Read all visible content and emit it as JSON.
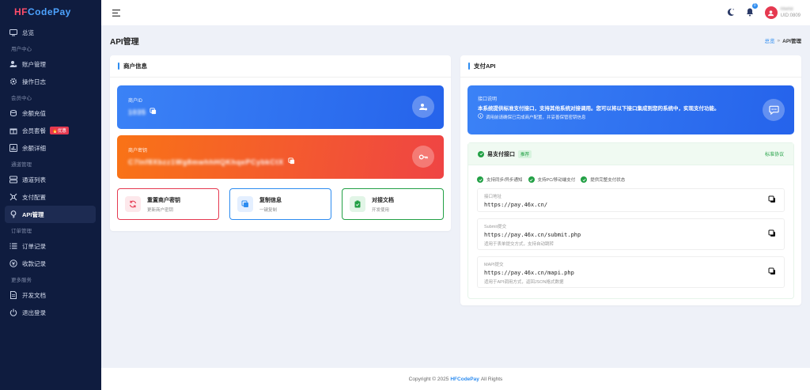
{
  "brand": {
    "logo_part1": "HF",
    "logo_part2": "CodePay"
  },
  "sidebar": {
    "items": [
      {
        "type": "item",
        "label": "总览",
        "icon": "monitor-icon"
      },
      {
        "type": "section",
        "label": "用户中心"
      },
      {
        "type": "item",
        "label": "账户管理",
        "icon": "user-gear-icon"
      },
      {
        "type": "item",
        "label": "操作日志",
        "icon": "settings-icon"
      },
      {
        "type": "section",
        "label": "会员中心"
      },
      {
        "type": "item",
        "label": "余额充值",
        "icon": "coins-icon"
      },
      {
        "type": "item",
        "label": "会员套餐",
        "icon": "gift-icon",
        "badge": "🔥优惠"
      },
      {
        "type": "item",
        "label": "余额详细",
        "icon": "chart-icon"
      },
      {
        "type": "section",
        "label": "通道管理"
      },
      {
        "type": "item",
        "label": "通道列表",
        "icon": "server-icon"
      },
      {
        "type": "item",
        "label": "支付配置",
        "icon": "config-icon"
      },
      {
        "type": "item",
        "label": "API管理",
        "icon": "key-icon",
        "active": true
      },
      {
        "type": "section",
        "label": "订单管理"
      },
      {
        "type": "item",
        "label": "订单记录",
        "icon": "list-icon"
      },
      {
        "type": "item",
        "label": "收款记录",
        "icon": "receipt-icon"
      },
      {
        "type": "section",
        "label": "更多服务"
      },
      {
        "type": "item",
        "label": "开发文档",
        "icon": "doc-icon"
      },
      {
        "type": "item",
        "label": "退出登录",
        "icon": "power-icon"
      }
    ]
  },
  "topbar": {
    "notification_count": "0",
    "user_name": "hfwh8",
    "user_uid": "UID:0809"
  },
  "page": {
    "title": "API管理",
    "breadcrumb_home": "总览",
    "breadcrumb_sep": "»",
    "breadcrumb_current": "API管理"
  },
  "merchant": {
    "card_title": "商户信息",
    "id_label": "商户ID",
    "id_value": "1035",
    "key_label": "商户密钥",
    "key_value": "C7lnf8Xbzz1Wg8mwhhHQKhqePCybkCtX",
    "actions": [
      {
        "title": "重置商户密钥",
        "sub": "更新商户密钥",
        "color": "#e53950"
      },
      {
        "title": "复制信息",
        "sub": "一键复制",
        "color": "#2d8cf0"
      },
      {
        "title": "对接文档",
        "sub": "开发使用",
        "color": "#22a045"
      }
    ]
  },
  "api": {
    "card_title": "支付API",
    "desc_title": "接口说明",
    "desc_text": "本系统提供标准支付接口，支持其他系统对接调用。您可以将以下接口集成到您的系统中，实现支付功能。",
    "desc_note": "调用前请确保已完成商户配置，并妥善保管密钥信息",
    "panel_title": "易支付接口",
    "panel_tag": "推荐",
    "panel_link": "标准协议",
    "features": [
      "支持同步/异步通知",
      "支持PC/移动端支付",
      "提供完整支付状态"
    ],
    "endpoints": [
      {
        "label": "接口地址",
        "url": "https://pay.46x.cn/",
        "hint": ""
      },
      {
        "label": "Submit提交",
        "url": "https://pay.46x.cn/submit.php",
        "hint": "适用于表单提交方式，支持自动跳转"
      },
      {
        "label": "MAPI提交",
        "url": "https://pay.46x.cn/mapi.php",
        "hint": "适用于API调用方式，返回JSON格式数据"
      }
    ]
  },
  "footer": {
    "prefix": "Copyright © 2025",
    "brand": "HFCodePay",
    "suffix": "All Rights"
  }
}
